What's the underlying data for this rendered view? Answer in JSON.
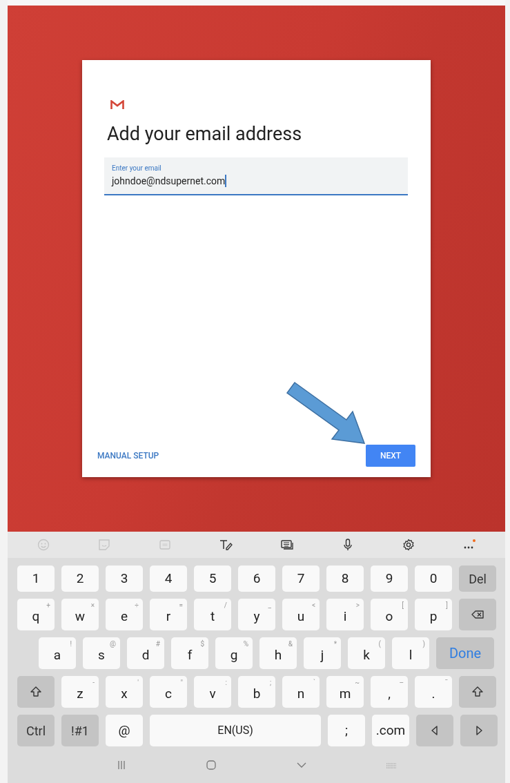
{
  "dialog": {
    "title": "Add your email address",
    "email_field": {
      "label": "Enter your email",
      "value": "johndoe@ndsupernet.com",
      "focused": true
    },
    "manual_setup": "MANUAL SETUP",
    "next_button": "NEXT"
  },
  "keyboard": {
    "toolbar": [
      {
        "kind": "emoji",
        "disabled": true
      },
      {
        "kind": "sticker",
        "disabled": true
      },
      {
        "kind": "gif",
        "disabled": true
      },
      {
        "kind": "handwriting",
        "disabled": false
      },
      {
        "kind": "keyboard",
        "disabled": false
      },
      {
        "kind": "mic",
        "disabled": false
      },
      {
        "kind": "settings",
        "disabled": false
      },
      {
        "kind": "more",
        "disabled": false
      }
    ],
    "rows": {
      "number_row": [
        {
          "kind": "char",
          "label": "1"
        },
        {
          "kind": "char",
          "label": "2"
        },
        {
          "kind": "char",
          "label": "3"
        },
        {
          "kind": "char",
          "label": "4"
        },
        {
          "kind": "char",
          "label": "5"
        },
        {
          "kind": "char",
          "label": "6"
        },
        {
          "kind": "char",
          "label": "7"
        },
        {
          "kind": "char",
          "label": "8"
        },
        {
          "kind": "char",
          "label": "9"
        },
        {
          "kind": "char",
          "label": "0"
        },
        {
          "kind": "func",
          "label": "Del"
        }
      ],
      "top_row": [
        {
          "kind": "char",
          "label": "q",
          "hint": "+"
        },
        {
          "kind": "char",
          "label": "w",
          "hint": "×"
        },
        {
          "kind": "char",
          "label": "e",
          "hint": "÷"
        },
        {
          "kind": "char",
          "label": "r",
          "hint": "="
        },
        {
          "kind": "char",
          "label": "t",
          "hint": "/"
        },
        {
          "kind": "char",
          "label": "y",
          "hint": "_"
        },
        {
          "kind": "char",
          "label": "u",
          "hint": "<"
        },
        {
          "kind": "char",
          "label": "i",
          "hint": ">"
        },
        {
          "kind": "char",
          "label": "o",
          "hint": "["
        },
        {
          "kind": "char",
          "label": "p",
          "hint": "]"
        },
        {
          "kind": "backspace"
        }
      ],
      "home_row": [
        {
          "kind": "char",
          "label": "a",
          "hint": "!"
        },
        {
          "kind": "char",
          "label": "s",
          "hint": "@"
        },
        {
          "kind": "char",
          "label": "d",
          "hint": "#"
        },
        {
          "kind": "char",
          "label": "f",
          "hint": "$"
        },
        {
          "kind": "char",
          "label": "g",
          "hint": "%"
        },
        {
          "kind": "char",
          "label": "h",
          "hint": "&"
        },
        {
          "kind": "char",
          "label": "j",
          "hint": "*"
        },
        {
          "kind": "char",
          "label": "k",
          "hint": "("
        },
        {
          "kind": "char",
          "label": "l",
          "hint": ")"
        },
        {
          "kind": "done",
          "label": "Done"
        }
      ],
      "bottom_letter_row": [
        {
          "kind": "shift"
        },
        {
          "kind": "char",
          "label": "z",
          "hint": "-"
        },
        {
          "kind": "char",
          "label": "x",
          "hint": "'"
        },
        {
          "kind": "char",
          "label": "c",
          "hint": "\""
        },
        {
          "kind": "char",
          "label": "v",
          "hint": ":"
        },
        {
          "kind": "char",
          "label": "b",
          "hint": ";"
        },
        {
          "kind": "char",
          "label": "n",
          "hint": "`"
        },
        {
          "kind": "char",
          "label": "m",
          "hint": "~"
        },
        {
          "kind": "char",
          "label": ",",
          "hint": "–"
        },
        {
          "kind": "char",
          "label": ".",
          "hint": "¯"
        },
        {
          "kind": "shift"
        }
      ],
      "space_row": [
        {
          "kind": "func",
          "label": "Ctrl"
        },
        {
          "kind": "func",
          "label": "!#1"
        },
        {
          "kind": "char",
          "label": "@"
        },
        {
          "kind": "space",
          "label": "EN(US)"
        },
        {
          "kind": "char",
          "label": ";"
        },
        {
          "kind": "char",
          "label": ".com"
        },
        {
          "kind": "left"
        },
        {
          "kind": "right"
        }
      ]
    }
  }
}
